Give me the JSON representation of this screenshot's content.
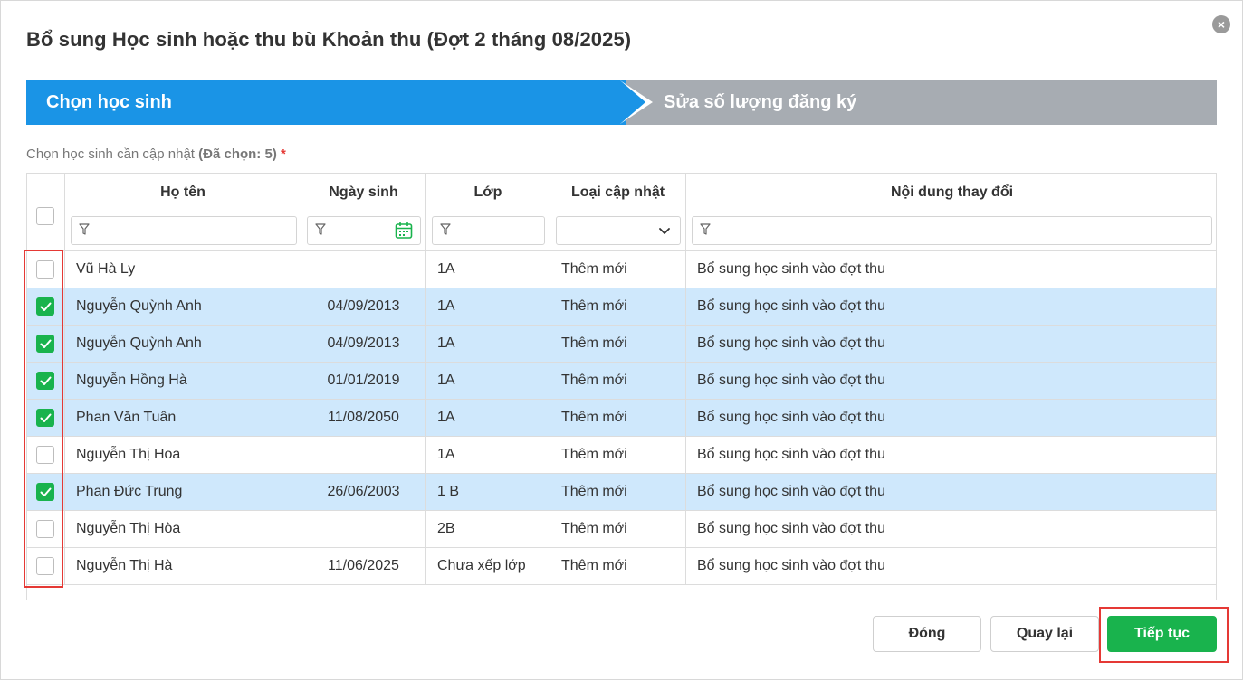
{
  "dialog": {
    "title": "Bổ sung Học sinh hoặc thu bù Khoản thu (Đợt 2 tháng 08/2025)",
    "close_symbol": "×"
  },
  "stepper": {
    "steps": [
      {
        "label": "Chọn học sinh",
        "active": true
      },
      {
        "label": "Sửa số lượng đăng ký",
        "active": false
      }
    ]
  },
  "selection": {
    "prompt": "Chọn học sinh cần cập nhật",
    "count_label": "(Đã chọn: 5)",
    "required_mark": "*"
  },
  "table": {
    "columns": [
      "Họ tên",
      "Ngày sinh",
      "Lớp",
      "Loại cập nhật",
      "Nội dung thay đổi"
    ],
    "rows": [
      {
        "checked": false,
        "name": "Vũ Hà Ly",
        "dob": "",
        "class": "1A",
        "type": "Thêm mới",
        "content": "Bổ sung học sinh vào đợt thu"
      },
      {
        "checked": true,
        "name": "Nguyễn Quỳnh Anh",
        "dob": "04/09/2013",
        "class": "1A",
        "type": "Thêm mới",
        "content": "Bổ sung học sinh vào đợt thu"
      },
      {
        "checked": true,
        "name": "Nguyễn Quỳnh Anh",
        "dob": "04/09/2013",
        "class": "1A",
        "type": "Thêm mới",
        "content": "Bổ sung học sinh vào đợt thu"
      },
      {
        "checked": true,
        "name": "Nguyễn Hồng Hà",
        "dob": "01/01/2019",
        "class": "1A",
        "type": "Thêm mới",
        "content": "Bổ sung học sinh vào đợt thu"
      },
      {
        "checked": true,
        "name": "Phan Văn Tuân",
        "dob": "11/08/2050",
        "class": "1A",
        "type": "Thêm mới",
        "content": "Bổ sung học sinh vào đợt thu"
      },
      {
        "checked": false,
        "name": "Nguyễn Thị Hoa",
        "dob": "",
        "class": "1A",
        "type": "Thêm mới",
        "content": "Bổ sung học sinh vào đợt thu"
      },
      {
        "checked": true,
        "name": "Phan Đức Trung",
        "dob": "26/06/2003",
        "class": "1 B",
        "type": "Thêm mới",
        "content": "Bổ sung học sinh vào đợt thu"
      },
      {
        "checked": false,
        "name": "Nguyễn Thị Hòa",
        "dob": "",
        "class": "2B",
        "type": "Thêm mới",
        "content": "Bổ sung học sinh vào đợt thu"
      },
      {
        "checked": false,
        "name": "Nguyễn Thị Hà",
        "dob": "11/06/2025",
        "class": "Chưa xếp lớp",
        "type": "Thêm mới",
        "content": "Bổ sung học sinh vào đợt thu"
      }
    ]
  },
  "buttons": {
    "close": "Đóng",
    "back": "Quay lại",
    "next": "Tiếp tục"
  },
  "colors": {
    "primary": "#1a94e6",
    "inactive_step": "#a7acb2",
    "selected_row": "#cfe8fc",
    "success": "#19b34d",
    "highlight": "#e53935"
  },
  "icons": {
    "filter": "filter-icon",
    "calendar": "calendar-icon",
    "dropdown": "chevron-down-icon",
    "checkmark": "check-icon",
    "close": "close-icon"
  }
}
